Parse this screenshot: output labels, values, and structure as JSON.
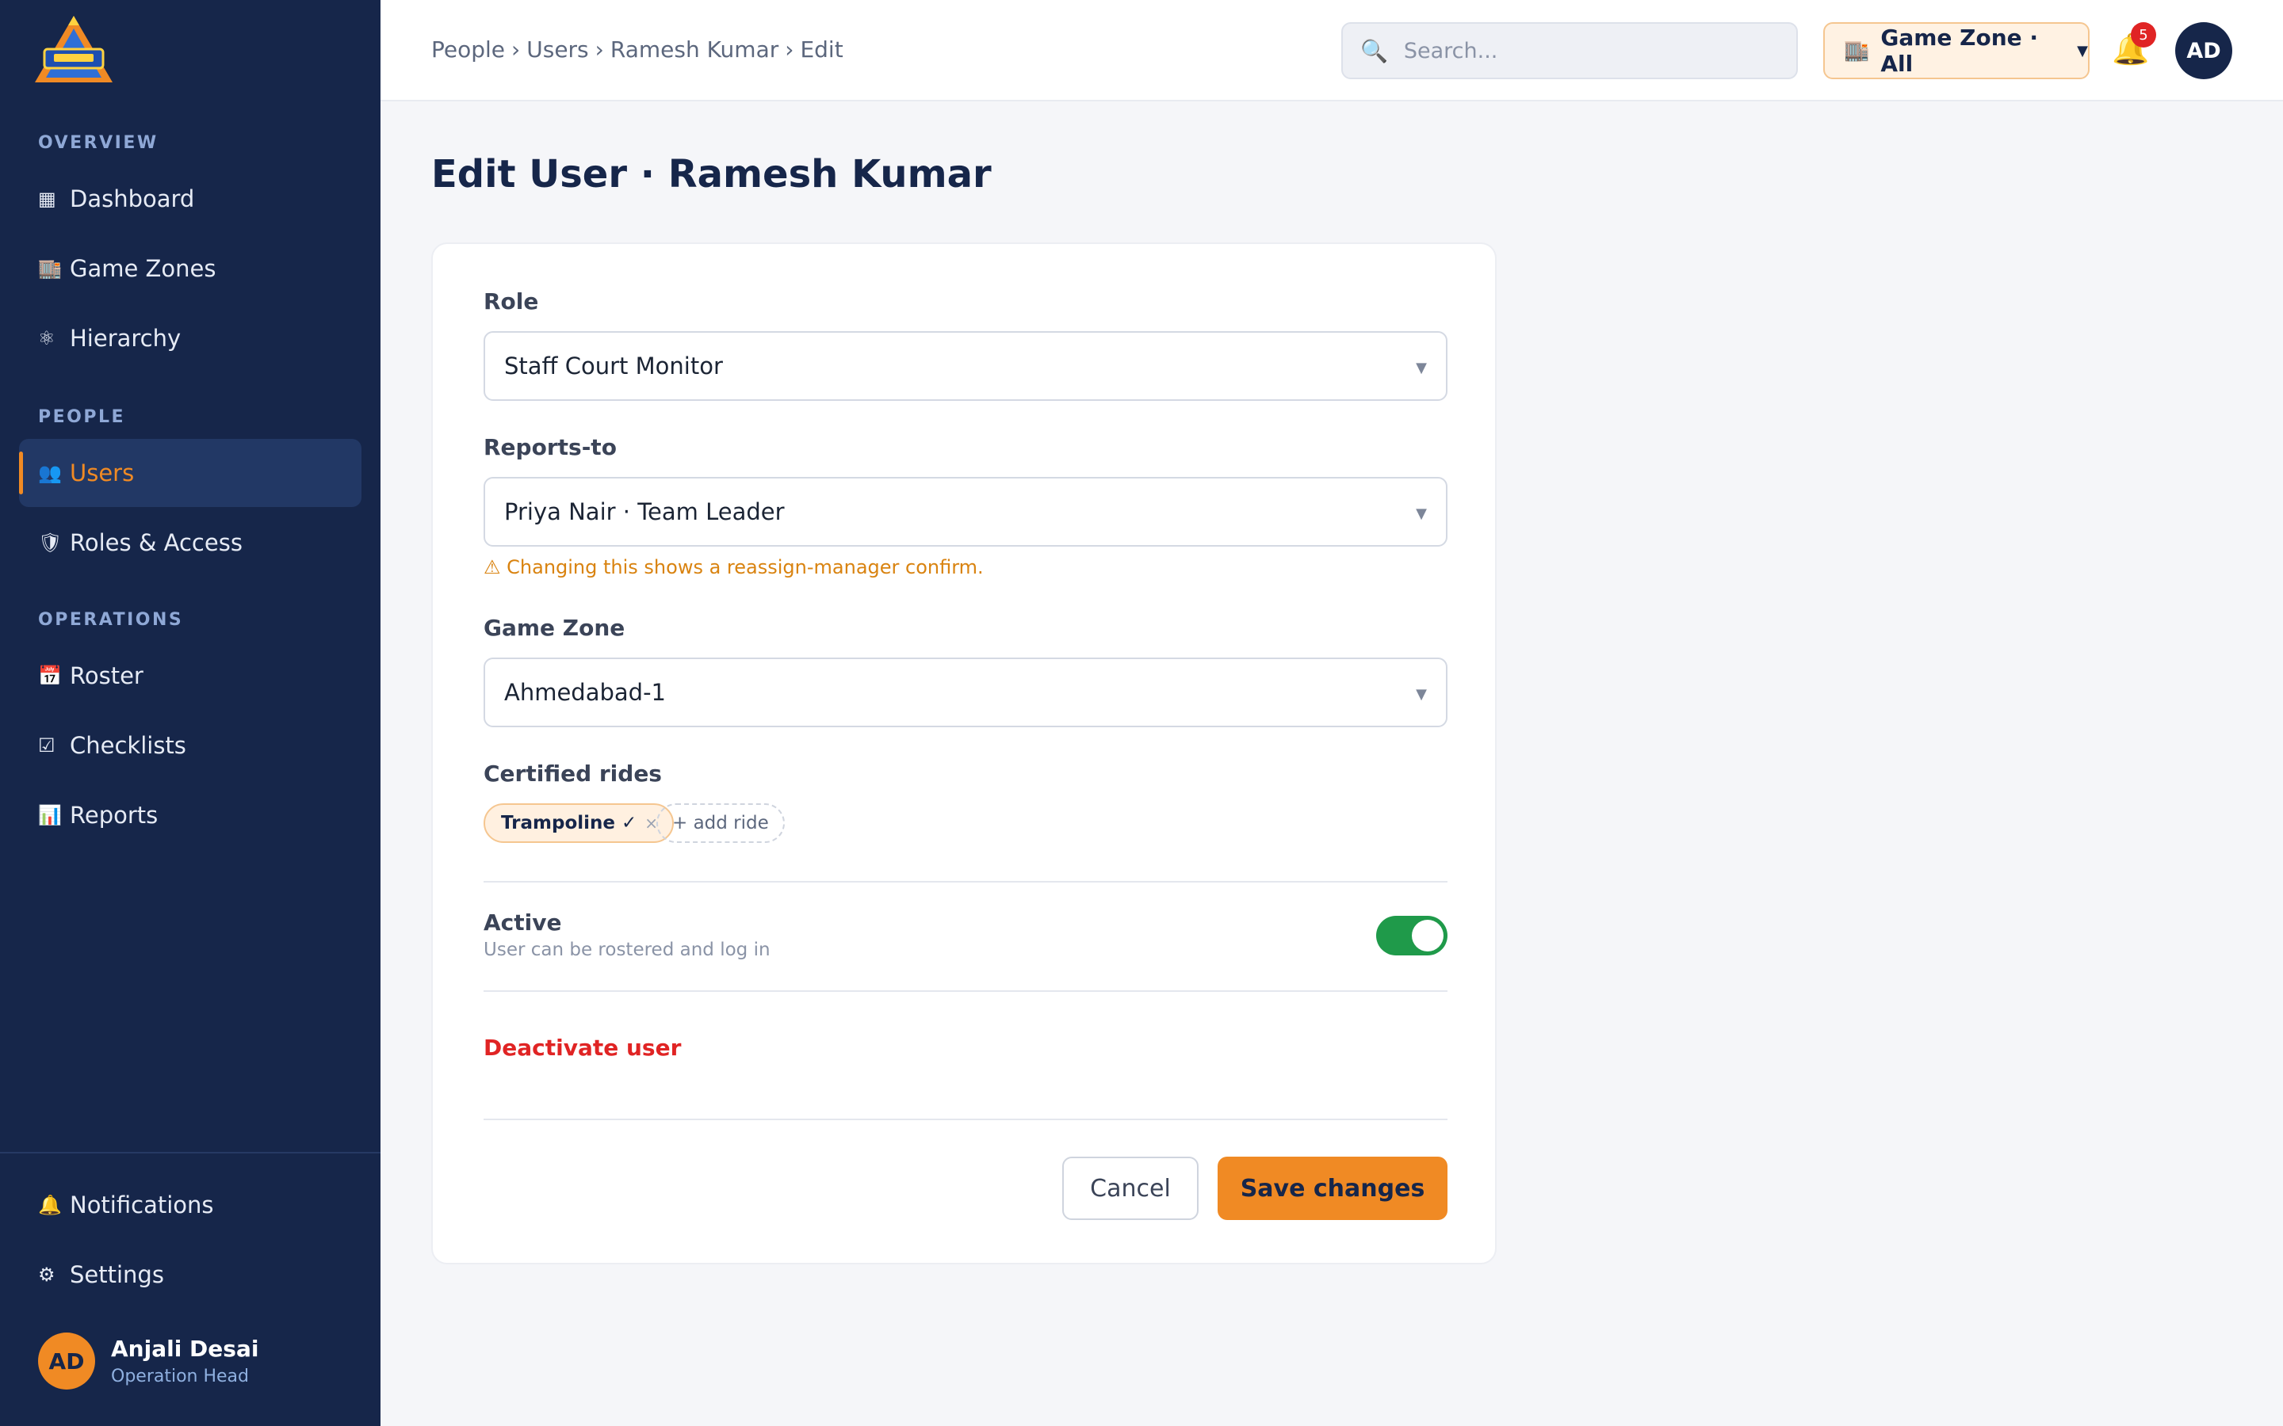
{
  "sidebar": {
    "sections": {
      "overview": "OVERVIEW",
      "people": "PEOPLE",
      "operations": "OPERATIONS"
    },
    "items": [
      {
        "label": "Dashboard",
        "icon": "▦"
      },
      {
        "label": "Game Zones",
        "icon": "🏬"
      },
      {
        "label": "Hierarchy",
        "icon": "⚛"
      },
      {
        "label": "Users",
        "icon": "👥"
      },
      {
        "label": "Roles & Access",
        "icon": "🛡"
      },
      {
        "label": "Roster",
        "icon": "📅"
      },
      {
        "label": "Checklists",
        "icon": "☑"
      },
      {
        "label": "Reports",
        "icon": "📊"
      },
      {
        "label": "Notifications",
        "icon": "🔔"
      },
      {
        "label": "Settings",
        "icon": "⚙"
      }
    ],
    "active_item": "Users",
    "profile": {
      "initials": "AD",
      "name": "Anjali Desai",
      "role": "Operation Head"
    }
  },
  "topbar": {
    "breadcrumb": [
      "People",
      "Users",
      "Ramesh Kumar",
      "Edit"
    ],
    "breadcrumb_sep": "›",
    "search_placeholder": "Search...",
    "zone_selector": "Game Zone · All",
    "notification_count": "5",
    "user_initials": "AD"
  },
  "page": {
    "title": "Edit User · Ramesh Kumar"
  },
  "form": {
    "role": {
      "label": "Role",
      "value": "Staff Court Monitor"
    },
    "reports_to": {
      "label": "Reports-to",
      "value": "Priya Nair · Team Leader",
      "warning": "⚠ Changing this shows a reassign-manager confirm."
    },
    "game_zone": {
      "label": "Game Zone",
      "value": "Ahmedabad-1"
    },
    "certified_rides": {
      "label": "Certified rides",
      "chips": [
        "Trampoline ✓"
      ],
      "remove_glyph": "×",
      "add_label": "+ add ride"
    },
    "active": {
      "label": "Active",
      "description": "User can be rostered and log in",
      "enabled": true
    },
    "deactivate_label": "Deactivate user",
    "cancel_label": "Cancel",
    "save_label": "Save changes"
  },
  "colors": {
    "sidebar_bg": "#16264a",
    "accent": "#f08a24",
    "danger": "#e02424",
    "toggle_on": "#1f9a4a",
    "warning": "#d98310"
  }
}
